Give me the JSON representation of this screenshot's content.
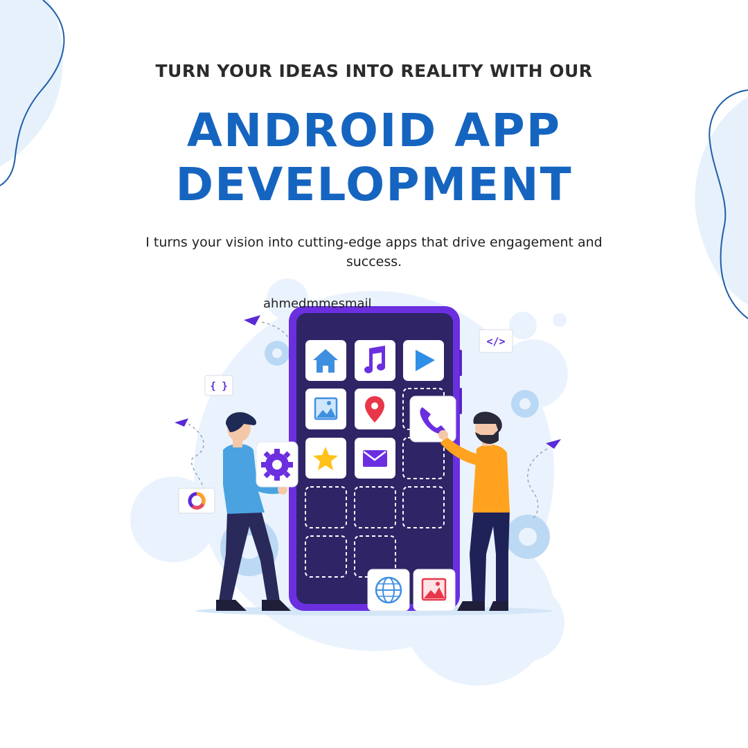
{
  "header": {
    "eyebrow": "TURN YOUR IDEAS INTO REALITY WITH OUR",
    "headline_line1": "ANDROID APP",
    "headline_line2": "DEVELOPMENT",
    "tagline": "I turns your vision into cutting-edge apps that drive engagement and success."
  },
  "watermark": "ahmedmmesmail",
  "colors": {
    "brand_blue": "#1565c0",
    "phone_purple": "#6b2fe0",
    "screen_dark": "#2e2466",
    "accent_orange": "#ffa21f",
    "shirt_blue": "#4aa3e0",
    "pale_blue": "#e8f2fc"
  },
  "illustration": {
    "app_icons": [
      "home-icon",
      "music-icon",
      "play-icon",
      "image-icon",
      "location-pin-icon",
      "phone-icon",
      "star-icon",
      "mail-icon",
      "globe-icon",
      "picture-icon",
      "settings-icon"
    ],
    "badges": [
      "</>",
      "{ }"
    ]
  }
}
